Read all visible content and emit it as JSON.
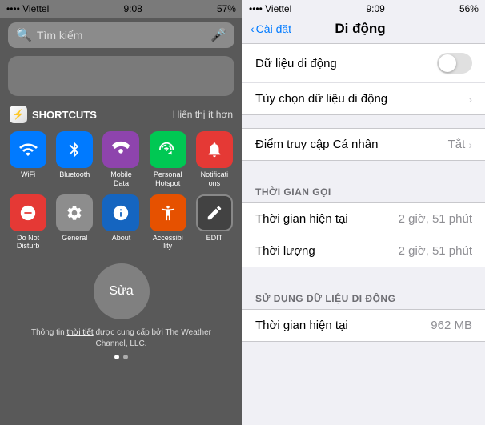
{
  "left": {
    "status": {
      "carrier": "•••• Viettel",
      "time": "9:08",
      "battery": "57%"
    },
    "search": {
      "placeholder": "Tìm kiếm"
    },
    "shortcuts": {
      "title": "SHORTCUTS",
      "toggle": "Hiển thị ít hơn",
      "items": [
        {
          "id": "wifi",
          "label": "WiFi",
          "icon": "📶",
          "color": "#007AFF"
        },
        {
          "id": "bluetooth",
          "label": "Bluetooth",
          "icon": "🦷",
          "color": "#007AFF"
        },
        {
          "id": "mobile-data",
          "label": "Mobile\nData",
          "icon": "📊",
          "color": "#8E44AD"
        },
        {
          "id": "hotspot",
          "label": "Personal\nHotspot",
          "icon": "🔗",
          "color": "#00C853"
        },
        {
          "id": "notifications",
          "label": "Notificati\nons",
          "icon": "🔔",
          "color": "#E53935"
        },
        {
          "id": "do-not-disturb",
          "label": "Do Not\nDisturb",
          "icon": "⛔",
          "color": "#E53935"
        },
        {
          "id": "general",
          "label": "General",
          "icon": "⚙️",
          "color": "#8D8D8D"
        },
        {
          "id": "about",
          "label": "About",
          "icon": "ℹ️",
          "color": "#1565C0"
        },
        {
          "id": "accessibility",
          "label": "Accessibi\nlity",
          "icon": "♿",
          "color": "#E65100"
        },
        {
          "id": "edit",
          "label": "EDIT",
          "icon": "✏️",
          "color": "#424242"
        }
      ]
    },
    "sua_button": "Sửa",
    "weather_text": "Thông tin ",
    "weather_link": "thời tiết",
    "weather_text2": " được cung cấp bởi\nThe Weather Channel, LLC."
  },
  "right": {
    "status": {
      "carrier": "•••• Viettel",
      "time": "9:09",
      "battery": "56%"
    },
    "nav": {
      "back": "Cài đặt",
      "title": "Di động"
    },
    "rows": [
      {
        "id": "mobile-data",
        "label": "Dữ liệu di động",
        "type": "toggle",
        "value": ""
      },
      {
        "id": "mobile-data-options",
        "label": "Tùy chọn dữ liệu di động",
        "type": "chevron",
        "value": ""
      }
    ],
    "personal_hotspot": {
      "label": "Điểm truy cập Cá nhân",
      "value": "Tắt"
    },
    "sections": [
      {
        "id": "thoi-gian-goi",
        "header": "THỜI GIAN GỌI",
        "rows": [
          {
            "id": "call-time-current",
            "label": "Thời gian hiện tại",
            "value": "2 giờ, 51 phút"
          },
          {
            "id": "call-time-lifetime",
            "label": "Thời lượng",
            "value": "2 giờ, 51 phút"
          }
        ]
      },
      {
        "id": "su-dung-du-lieu",
        "header": "SỬ DỤNG DỮ LIỆU DI ĐỘNG",
        "rows": [
          {
            "id": "data-current",
            "label": "Thời gian hiện tại",
            "value": "962 MB"
          }
        ]
      }
    ]
  }
}
